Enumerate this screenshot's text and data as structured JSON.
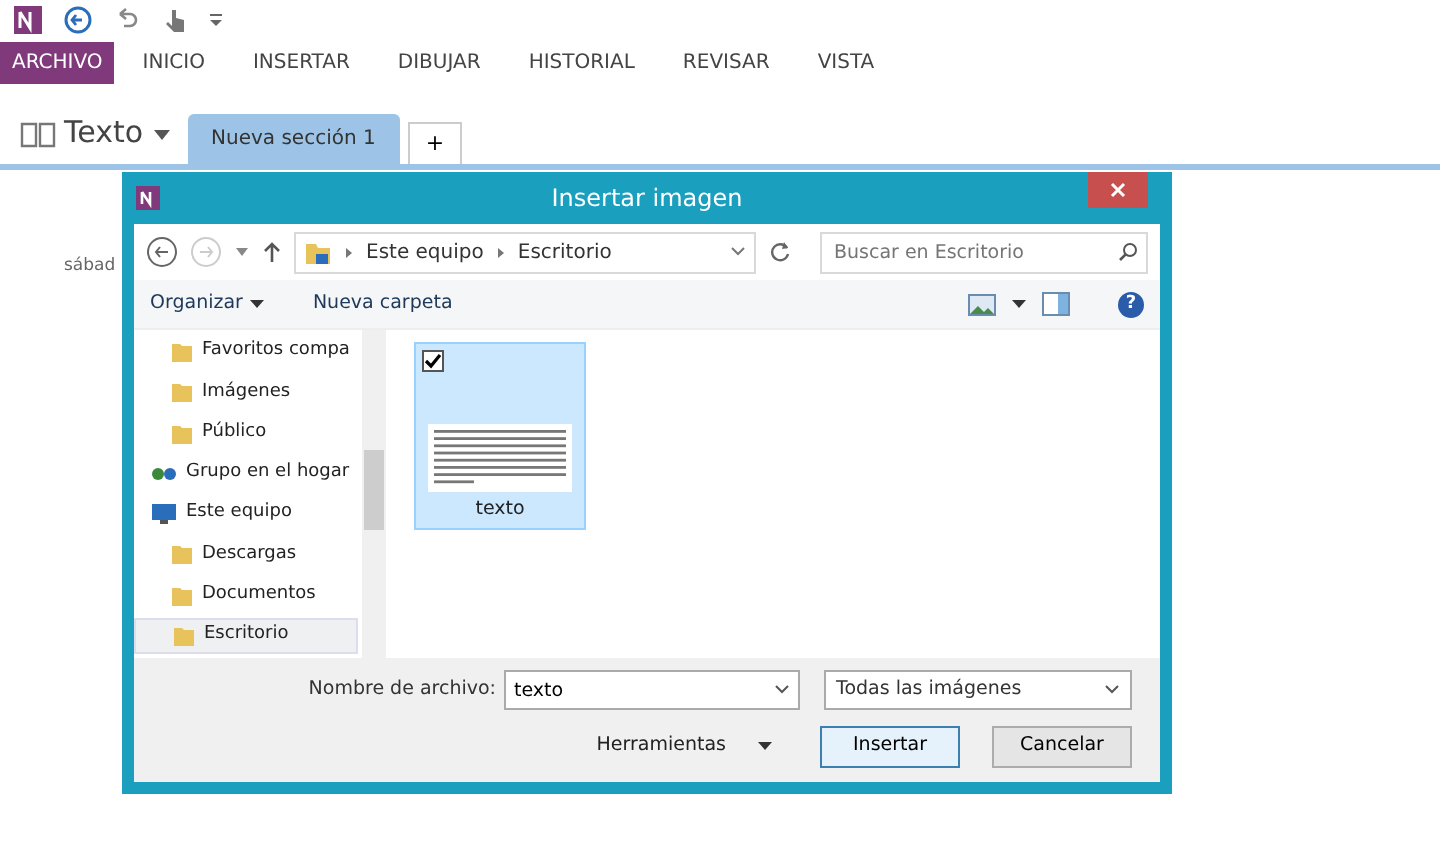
{
  "ribbon": {
    "file_tab": "ARCHIVO",
    "tabs": [
      {
        "label": "INICIO",
        "selected": false
      },
      {
        "label": "INSERTAR",
        "selected": false
      },
      {
        "label": "DIBUJAR",
        "selected": false
      },
      {
        "label": "HISTORIAL",
        "selected": false
      },
      {
        "label": "REVISAR",
        "selected": false
      },
      {
        "label": "VISTA",
        "selected": false
      }
    ]
  },
  "notebook": {
    "name": "Texto",
    "sections": [
      {
        "label": "Nueva sección 1",
        "selected": true
      }
    ],
    "add_tab": "+"
  },
  "page": {
    "date_fragment": "sábad"
  },
  "dialog": {
    "title": "Insertar imagen",
    "breadcrumb": [
      "Este equipo",
      "Escritorio"
    ],
    "search": {
      "placeholder": "Buscar en Escritorio"
    },
    "toolbar": [
      "Organizar",
      "Nueva carpeta"
    ],
    "help": "?",
    "nav_tree": [
      {
        "children": [
          {
            "label": "Favoritos compa",
            "selected": false
          },
          {
            "label": "Imágenes",
            "selected": false
          },
          {
            "label": "Público",
            "selected": false
          }
        ]
      },
      {
        "label": "Grupo en el hogar",
        "selected": false
      },
      {
        "label": "Este equipo",
        "selected": false,
        "children": [
          {
            "label": "Descargas",
            "selected": false
          },
          {
            "label": "Documentos",
            "selected": false
          },
          {
            "label": "Escritorio",
            "selected": true
          }
        ]
      }
    ],
    "files": [
      {
        "label": "texto",
        "selected": true,
        "checked": true
      }
    ],
    "filename_label": "Nombre de archivo:",
    "filename": "texto",
    "filter": "Todas las imágenes",
    "tools": "Herramientas",
    "buttons": [
      {
        "label": "Insertar",
        "kind": "default"
      },
      {
        "label": "Cancelar",
        "kind": "normal"
      }
    ]
  }
}
